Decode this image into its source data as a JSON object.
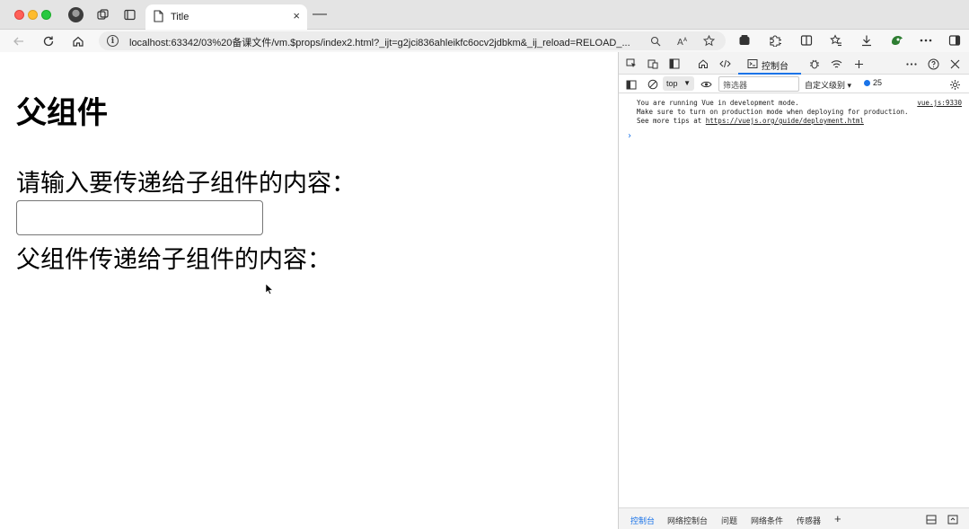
{
  "browser": {
    "tab": {
      "title": "Title",
      "close": "×"
    },
    "new_tab": "—",
    "url": "localhost:63342/03%20备课文件/vm.$props/index2.html?_ijt=g2jci836ahleikfc6ocv2jdbkm&_ij_reload=RELOAD_..."
  },
  "page": {
    "heading": "父组件",
    "input_label": "请输入要传递给子组件的内容：",
    "input_value": "",
    "received_label": "父组件传递给子组件的内容：",
    "received_value": ""
  },
  "devtools": {
    "console_tab": "控制台",
    "context": "top",
    "filter_placeholder": "筛选器",
    "levels": "自定义级别 ▾",
    "issues_count": "25",
    "messages": [
      "You are running Vue in development mode.",
      "Make sure to turn on production mode when deploying for production.",
      "See more tips at "
    ],
    "tips_link": "https://vuejs.org/guide/deployment.html",
    "source": "vue.js:9330",
    "prompt": "›",
    "drawer_tabs": [
      "控制台",
      "网络控制台",
      "问题",
      "网络条件",
      "传感器"
    ],
    "drawer_add": "+"
  },
  "colors": {
    "accent": "#1a73e8",
    "tabbar": "#e4e4e4",
    "traffic_red": "#ff5f57",
    "traffic_yellow": "#febc2e",
    "traffic_green": "#28c840"
  },
  "icons": [
    "profile-avatar",
    "workspaces-icon",
    "tab-actions-icon",
    "page-icon",
    "back-icon",
    "refresh-icon",
    "home-icon",
    "info-icon",
    "zoom-icon",
    "read-aloud-icon",
    "favorite-icon",
    "collections-icon",
    "extensions-icon",
    "split-screen-icon",
    "favorites-icon",
    "downloads-icon",
    "performance-icon",
    "more-icon",
    "sidebar-icon"
  ]
}
